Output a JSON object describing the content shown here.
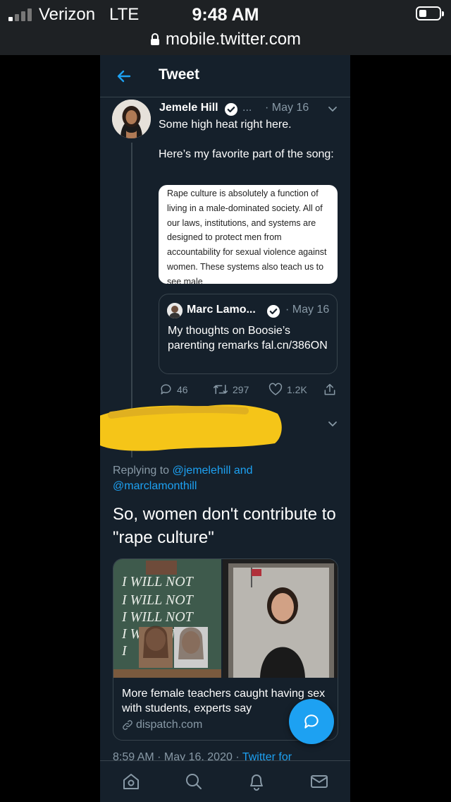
{
  "status_bar": {
    "carrier": "Verizon",
    "network": "LTE",
    "time": "9:48 AM",
    "signal_bars_filled": 1,
    "signal_bars_total": 4
  },
  "browser": {
    "url": "mobile.twitter.com"
  },
  "header": {
    "title": "Tweet"
  },
  "parent_tweet": {
    "author": "Jemele Hill",
    "ellipsis": "...",
    "date": "· May 16",
    "text_1": "Some high heat right here.",
    "text_2": "Here’s my favorite part of the song:",
    "screenshot_text": "Rape culture is absolutely a function of living in a male-dominated society. All of our laws, institutions, and systems are designed to protect men from accountability for sexual violence against women. These systems also teach us to see male",
    "quoted": {
      "author": "Marc Lamo...",
      "date": "· May 16",
      "text": "My thoughts on Boosie’s parenting remarks fal.cn/386ON"
    },
    "stats": {
      "replies": "46",
      "retweets": "297",
      "likes": "1.2K"
    }
  },
  "reply_tweet": {
    "replying_prefix": "Replying to ",
    "replying_to": "@jemelehill and @marclamonthill",
    "text": "So, women don't contribute to \"rape culture\"",
    "link_card": {
      "chalkboard_lines": [
        "I WILL NOT",
        "I WILL NOT",
        "I WILL NOT",
        "I WILL NOT",
        "I"
      ],
      "title": "More female teachers caught having sex with students, experts say",
      "domain": "dispatch.com"
    },
    "timestamp": "8:59 AM · May 16, 2020 · ",
    "source": "Twitter for"
  },
  "colors": {
    "background": "#15202b",
    "accent": "#1da1f2",
    "secondary_text": "#8899a6",
    "border": "#38444d",
    "redaction": "#f5c518"
  },
  "icons": [
    "back-arrow-icon",
    "verified-badge-icon",
    "chevron-down-icon",
    "reply-icon",
    "retweet-icon",
    "like-icon",
    "share-icon",
    "link-icon",
    "compose-icon",
    "home-icon",
    "search-icon",
    "notifications-icon",
    "messages-icon"
  ]
}
